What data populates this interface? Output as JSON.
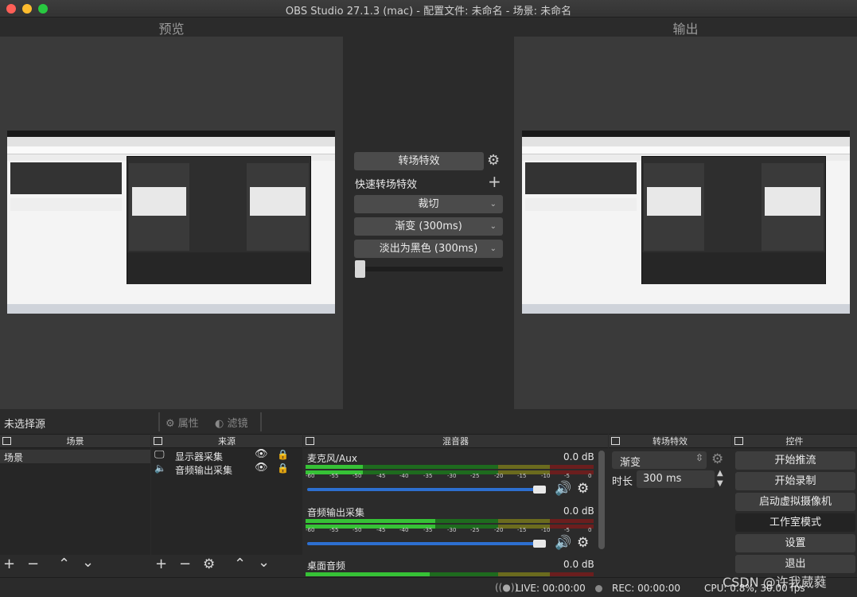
{
  "window": {
    "title": "OBS Studio 27.1.3 (mac) - 配置文件: 未命名 - 场景: 未命名",
    "traffic_colors": [
      "#fe5f57",
      "#febc2e",
      "#28c840"
    ]
  },
  "preview": {
    "label": "预览"
  },
  "output": {
    "label": "输出"
  },
  "transition_panel": {
    "transition_button": "转场特效",
    "quick_transitions_label": "快速转场特效",
    "items": [
      "裁切",
      "渐变 (300ms)",
      "淡出为黑色 (300ms)"
    ],
    "tbar_value": 0
  },
  "source_bar": {
    "no_source": "未选择源",
    "properties": "属性",
    "filters": "滤镜"
  },
  "docks": {
    "scenes": {
      "title": "场景",
      "items": [
        "场景"
      ]
    },
    "sources": {
      "title": "来源",
      "items": [
        {
          "label": "显示器采集",
          "icon": "monitor-icon"
        },
        {
          "label": "音频输出采集",
          "icon": "speaker-icon"
        }
      ]
    },
    "mixer": {
      "title": "混音器",
      "ticks": [
        "-60",
        "-55",
        "-50",
        "-45",
        "-40",
        "-35",
        "-30",
        "-25",
        "-20",
        "-15",
        "-10",
        "-5",
        "0"
      ],
      "channels": [
        {
          "name": "麦克风/Aux",
          "db": "0.0 dB",
          "volume": 1.0,
          "level": 0.2
        },
        {
          "name": "音频输出采集",
          "db": "0.0 dB",
          "volume": 1.0,
          "level": 0.45
        },
        {
          "name": "桌面音频",
          "db": "0.0 dB",
          "volume": 1.0,
          "level": 0.43
        }
      ]
    },
    "transitions": {
      "title": "转场特效",
      "selected": "渐变",
      "duration_label": "时长",
      "duration_value": "300 ms"
    },
    "controls": {
      "title": "控件",
      "buttons": [
        "开始推流",
        "开始录制",
        "启动虚拟摄像机",
        "工作室模式",
        "设置",
        "退出"
      ]
    }
  },
  "status": {
    "live": "LIVE: 00:00:00",
    "rec": "REC: 00:00:00",
    "cpu": "CPU: 0.8%, 30.00 fps"
  },
  "watermark": "CSDN @许我葳蕤"
}
